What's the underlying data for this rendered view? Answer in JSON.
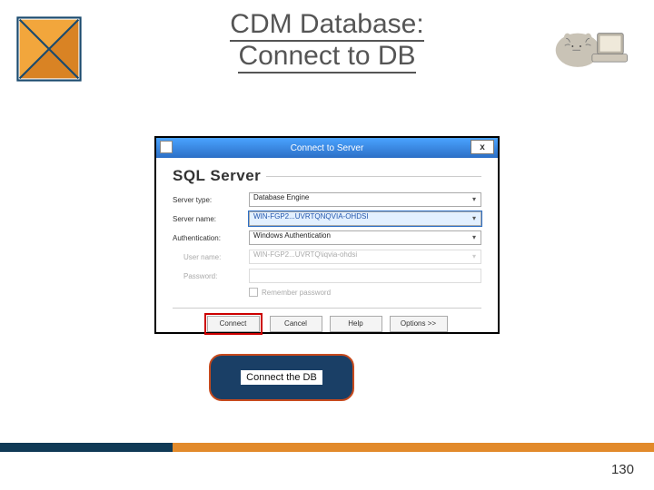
{
  "header": {
    "title_line1": "CDM Database:",
    "title_line2": "Connect to DB"
  },
  "dialog": {
    "title": "Connect to Server",
    "close_label": "x",
    "product": "SQL Server",
    "rows": {
      "server_type": {
        "label": "Server type:",
        "value": "Database Engine"
      },
      "server_name": {
        "label": "Server name:",
        "value": "WIN-FGP2...UVRTQNQVIA-OHDSI"
      },
      "auth": {
        "label": "Authentication:",
        "value": "Windows Authentication"
      },
      "user": {
        "label": "User name:",
        "value": "WIN-FGP2...UVRTQ\\iqvia-ohdsi"
      },
      "pass": {
        "label": "Password:",
        "value": ""
      },
      "remember": {
        "label": "Remember password"
      }
    },
    "buttons": {
      "connect": "Connect",
      "cancel": "Cancel",
      "help": "Help",
      "options": "Options >>"
    }
  },
  "callout": {
    "text": "Connect the DB"
  },
  "footer": {
    "page": "130"
  }
}
